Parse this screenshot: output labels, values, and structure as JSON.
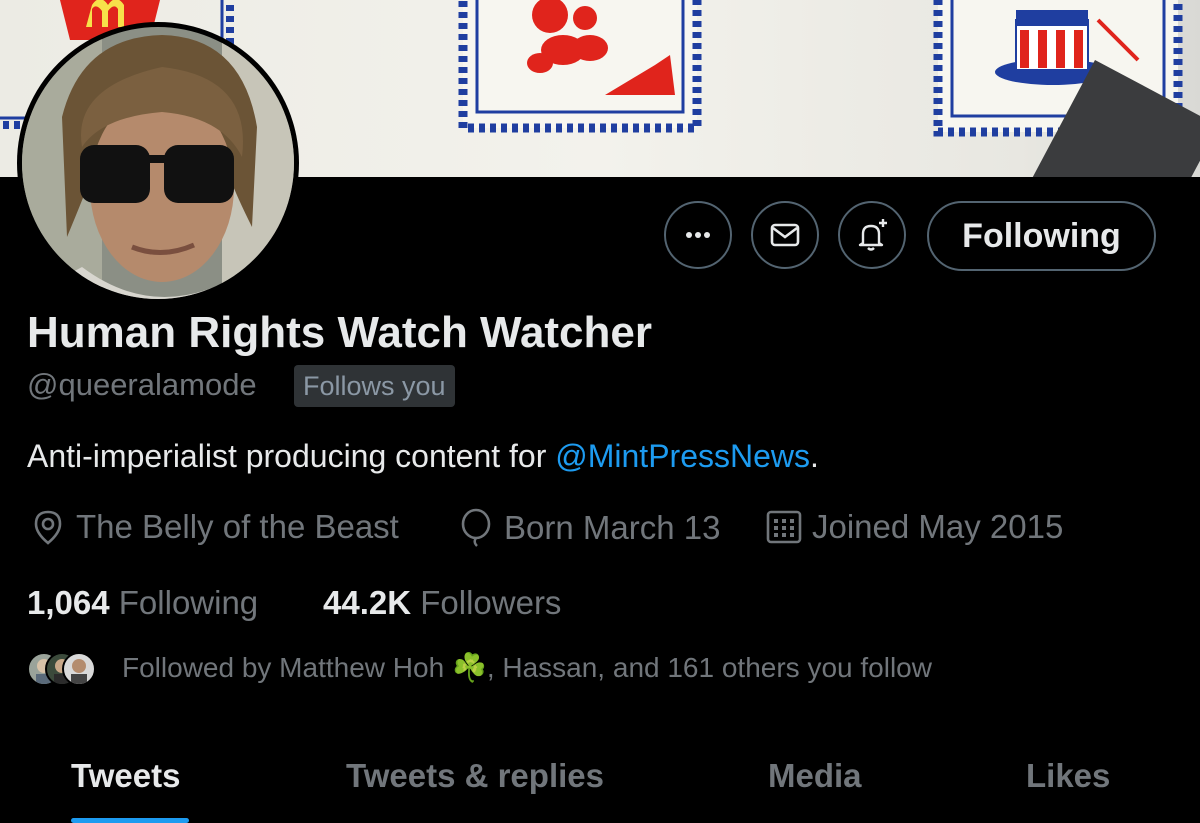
{
  "profile": {
    "display_name": "Human Rights Watch Watcher",
    "handle": "@queeralamode",
    "follows_you": "Follows you",
    "bio_text": "Anti-imperialist producing content for ",
    "bio_link": "@MintPressNews",
    "bio_end": ".",
    "location": "The Belly of the Beast",
    "birthday": "Born March 13",
    "joined": "Joined May 2015"
  },
  "actions": {
    "more_icon": "more-icon",
    "message_icon": "mail-icon",
    "notify_icon": "bell-plus-icon",
    "following_label": "Following"
  },
  "stats": {
    "following_count": "1,064",
    "following_label": "Following",
    "followers_count": "44.2K",
    "followers_label": "Followers"
  },
  "followed_by": {
    "text": "Followed by Matthew Hoh ",
    "emoji": "☘️",
    "text_end": ", Hassan, and 161 others you follow"
  },
  "tabs": [
    {
      "label": "Tweets",
      "active": true
    },
    {
      "label": "Tweets & replies",
      "active": false
    },
    {
      "label": "Media",
      "active": false
    },
    {
      "label": "Likes",
      "active": false
    }
  ],
  "colors": {
    "background": "#000000",
    "text_primary": "#e7e9ea",
    "text_secondary": "#71767b",
    "accent": "#1d9bf0",
    "border": "#536471",
    "stamp_blue": "#1f3ea0",
    "stamp_red": "#e0241c"
  }
}
